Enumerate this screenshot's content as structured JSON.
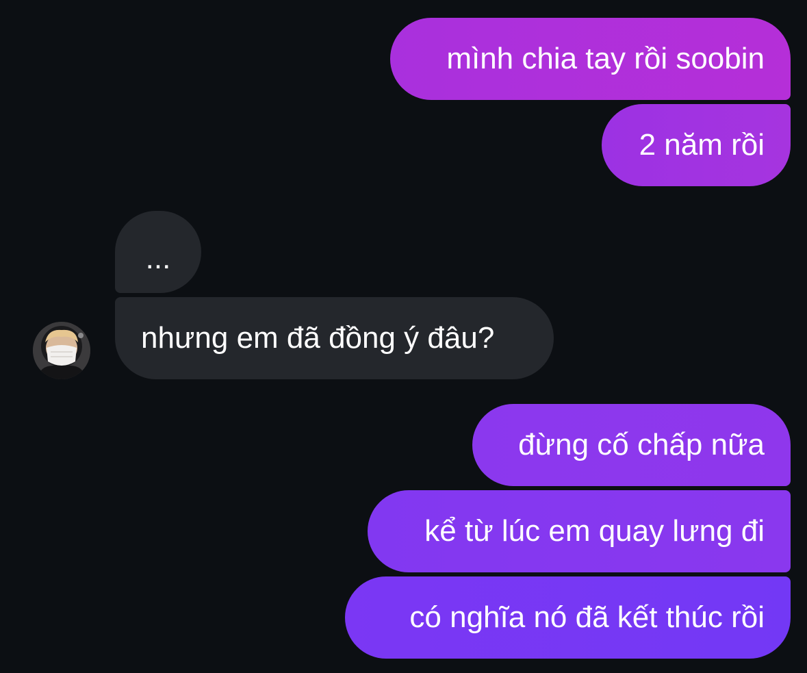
{
  "messages": [
    {
      "from": "me",
      "text": "mình chia tay rồi soobin"
    },
    {
      "from": "me",
      "text": "2 năm rồi"
    },
    {
      "from": "them",
      "text": "..."
    },
    {
      "from": "them",
      "text": "nhưng em đã đồng ý đâu?"
    },
    {
      "from": "me",
      "text": "đừng cố chấp nữa"
    },
    {
      "from": "me",
      "text": "kể từ lúc em quay lưng đi"
    },
    {
      "from": "me",
      "text": "có nghĩa nó đã kết thúc rồi"
    }
  ],
  "avatar_icon": "user-avatar-masked",
  "colors": {
    "background": "#0c0f13",
    "received_bubble": "#24272c",
    "sent_gradient_start": "#b52fd8",
    "sent_gradient_end": "#7338f5"
  }
}
